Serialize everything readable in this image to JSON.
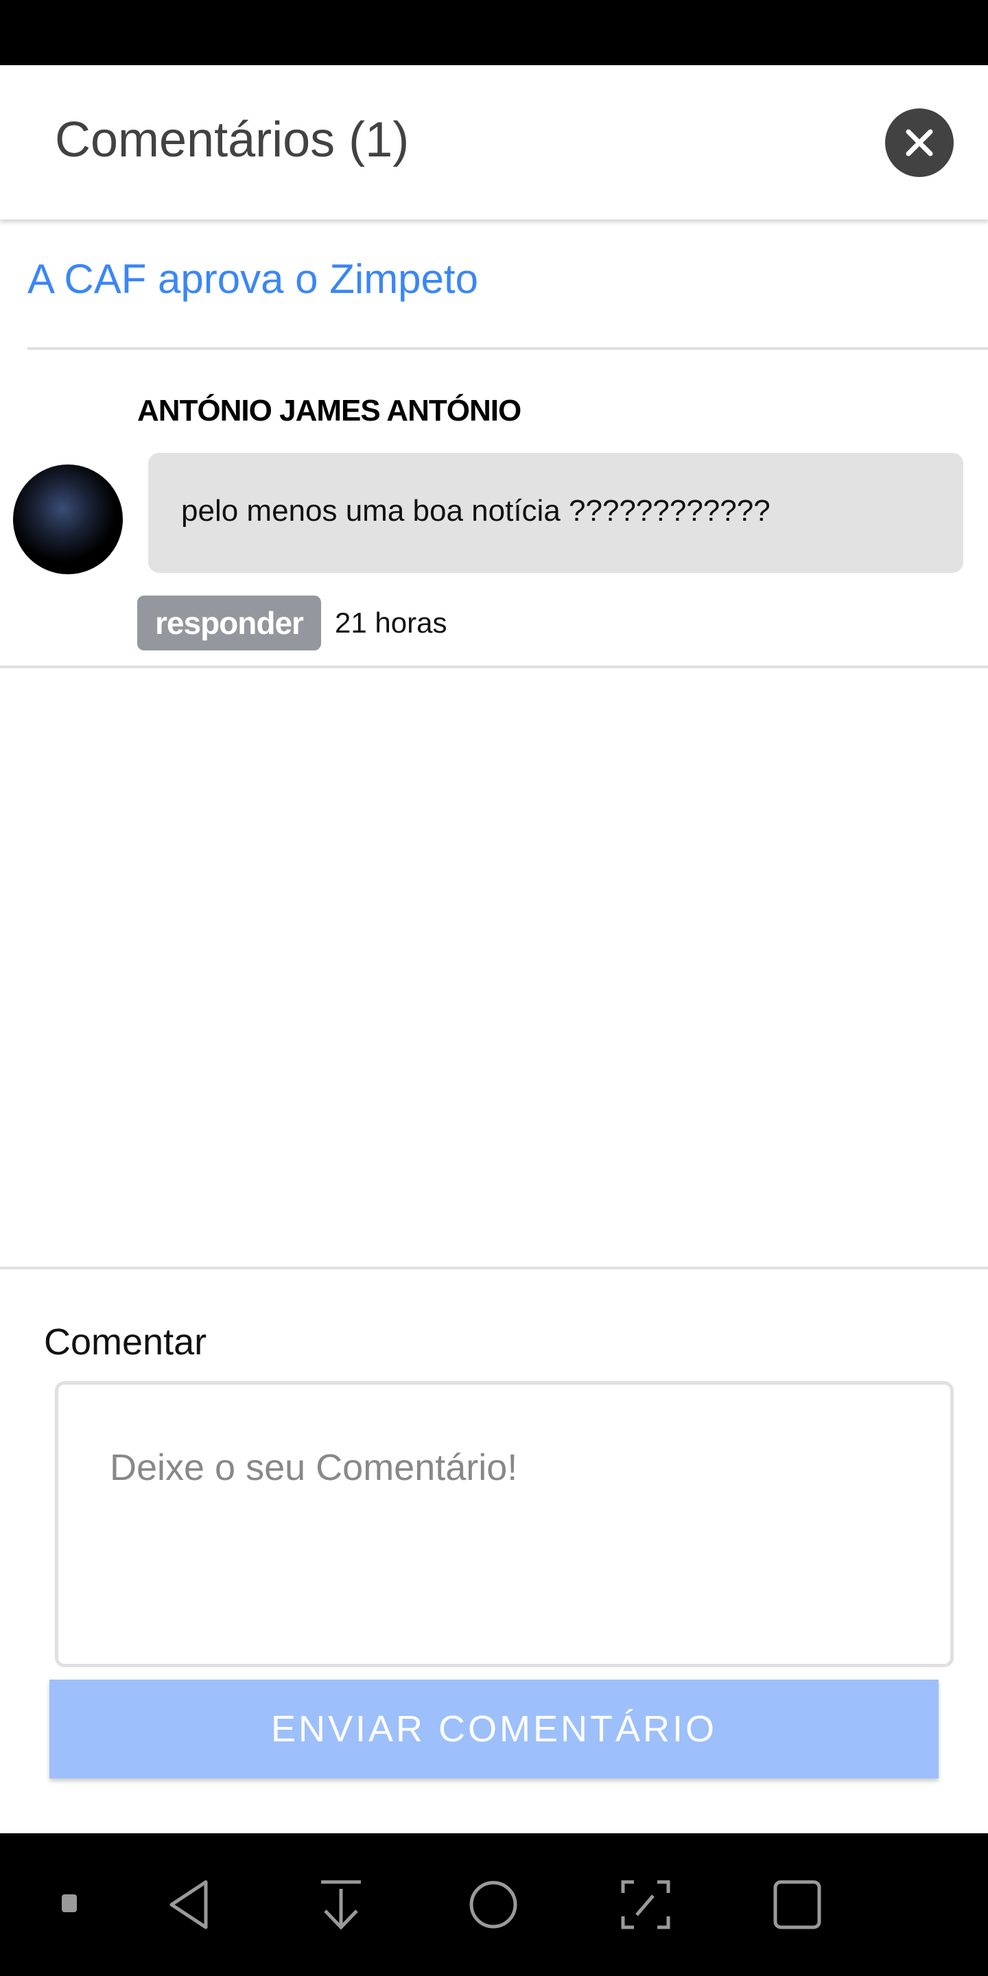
{
  "header": {
    "title": "Comentários (1)",
    "close_icon": "close-icon"
  },
  "article": {
    "link": "A CAF aprova o Zimpeto"
  },
  "comments": [
    {
      "author": "ANTÓNIO JAMES ANTÓNIO",
      "text": "pelo menos uma boa notícia ????????????",
      "reply_label": "responder",
      "time": "21 horas"
    }
  ],
  "form": {
    "label": "Comentar",
    "placeholder": "Deixe o seu Comentário!",
    "submit": "ENVIAR COMENTÁRIO"
  },
  "colors": {
    "accent": "#3a86f7",
    "button": "#9dbffb",
    "badge": "#95979e",
    "bubble": "#e2e2e2"
  }
}
